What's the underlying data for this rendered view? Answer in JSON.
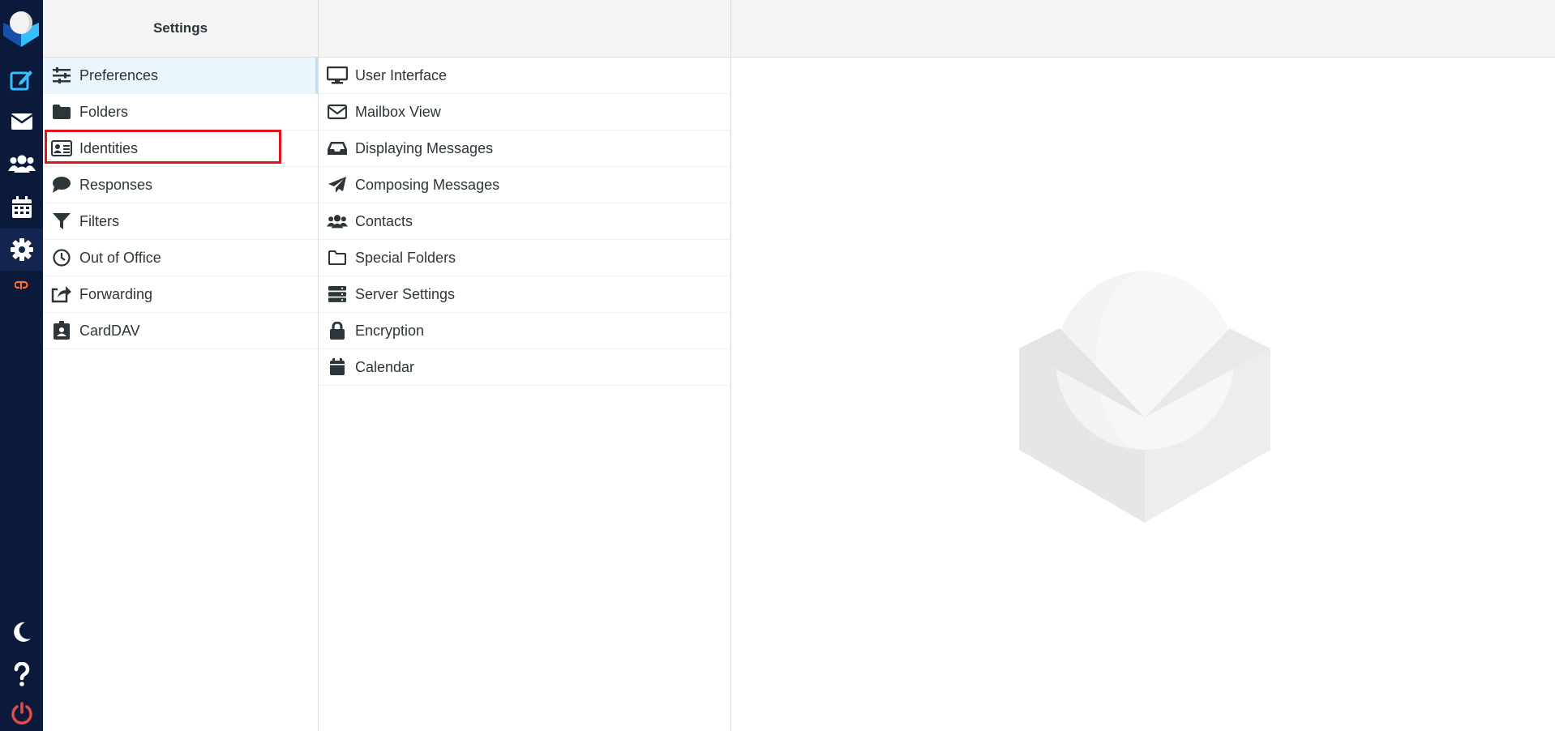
{
  "settings_header": "Settings",
  "sections": [
    {
      "label": "Preferences",
      "icon": "sliders-icon",
      "selected": true
    },
    {
      "label": "Folders",
      "icon": "folder-icon"
    },
    {
      "label": "Identities",
      "icon": "id-card-icon"
    },
    {
      "label": "Responses",
      "icon": "comment-icon"
    },
    {
      "label": "Filters",
      "icon": "filter-icon"
    },
    {
      "label": "Out of Office",
      "icon": "clock-icon"
    },
    {
      "label": "Forwarding",
      "icon": "share-icon"
    },
    {
      "label": "CardDAV",
      "icon": "address-book-icon"
    }
  ],
  "preferences": [
    {
      "label": "User Interface",
      "icon": "monitor-icon"
    },
    {
      "label": "Mailbox View",
      "icon": "envelope-icon"
    },
    {
      "label": "Displaying Messages",
      "icon": "inbox-icon"
    },
    {
      "label": "Composing Messages",
      "icon": "paper-plane-icon"
    },
    {
      "label": "Contacts",
      "icon": "users-icon"
    },
    {
      "label": "Special Folders",
      "icon": "folder-outline-icon"
    },
    {
      "label": "Server Settings",
      "icon": "server-icon"
    },
    {
      "label": "Encryption",
      "icon": "lock-icon"
    },
    {
      "label": "Calendar",
      "icon": "calendar-icon"
    }
  ],
  "nav": [
    "compose-icon",
    "mail-icon",
    "contacts-icon",
    "calendar-icon",
    "settings-icon",
    "cpanel-icon",
    "dark-mode-icon",
    "help-icon",
    "logout-icon"
  ],
  "colors": {
    "nav_bg": "#0b1a3a",
    "accent": "#37beff",
    "highlight": "#e0141b",
    "logout": "#e34a4a"
  }
}
